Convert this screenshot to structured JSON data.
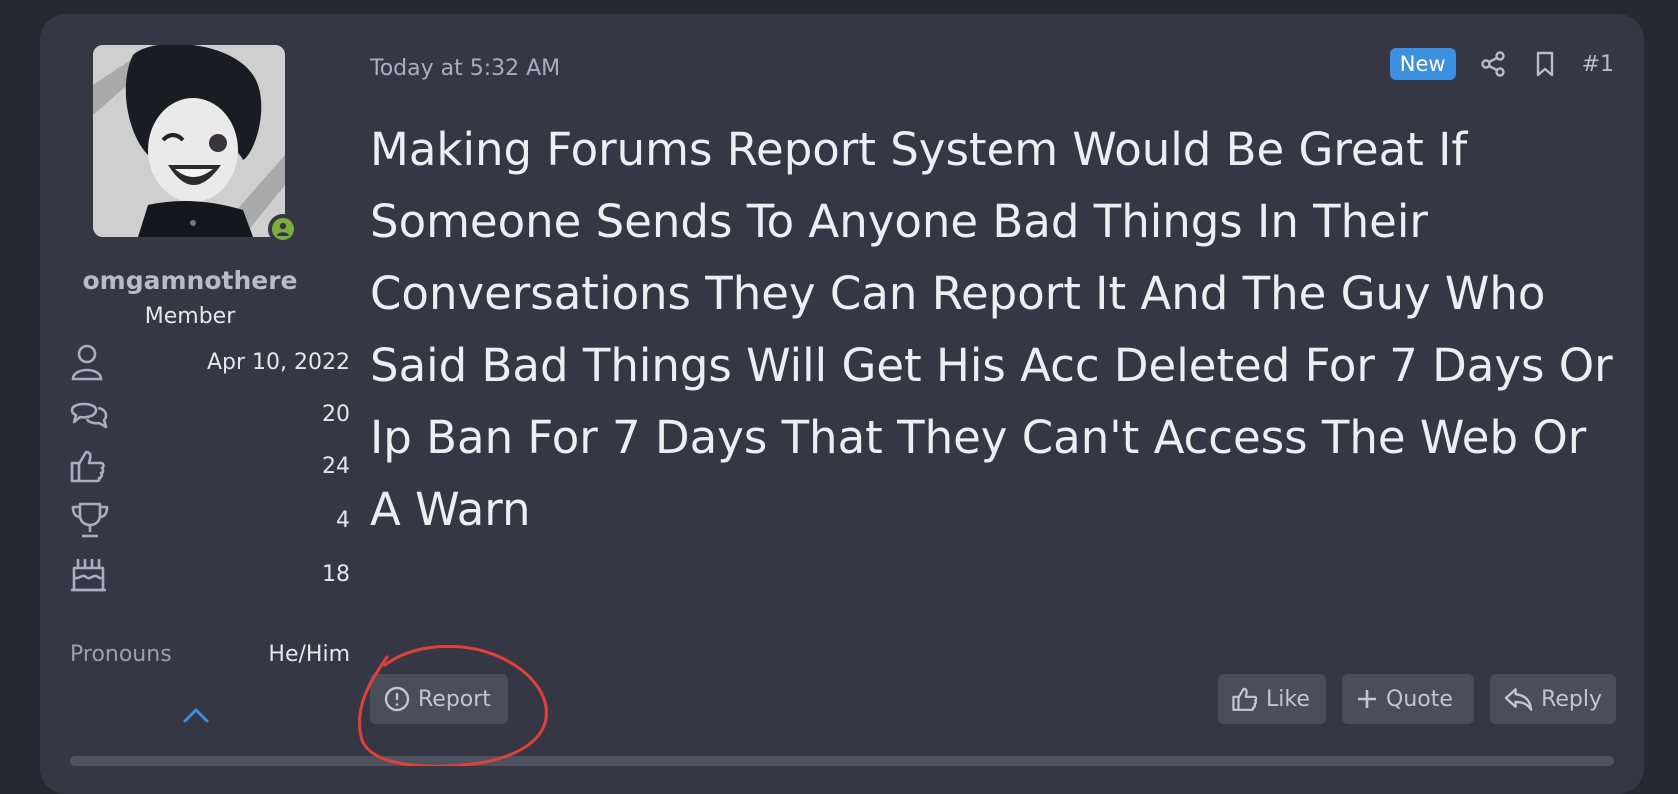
{
  "post": {
    "timestamp": "Today at 5:32 AM",
    "badge": "New",
    "post_number": "#1",
    "body": "Making Forums Report System Would Be Great If Someone Sends To Anyone Bad Things In Their Conversations They Can Report It And The Guy Who Said Bad Things Will Get His Acc Deleted For 7 Days Or Ip Ban For 7 Days That They Can't Access The Web Or A Warn"
  },
  "user": {
    "username": "omgamnothere",
    "title": "Member",
    "stats": [
      {
        "icon": "user-icon",
        "value": "Apr 10, 2022"
      },
      {
        "icon": "messages-icon",
        "value": "20"
      },
      {
        "icon": "thumbs-up-icon",
        "value": "24"
      },
      {
        "icon": "trophy-icon",
        "value": "4"
      },
      {
        "icon": "cake-icon",
        "value": "18"
      }
    ],
    "pronouns_label": "Pronouns",
    "pronouns_value": "He/Him"
  },
  "actions": {
    "report": "Report",
    "like": "Like",
    "quote": "Quote",
    "reply": "Reply"
  },
  "colors": {
    "background": "#262933",
    "card": "#353844",
    "accent": "#3d8fe0",
    "online": "#7cae3e",
    "annotation": "#e0403c"
  }
}
